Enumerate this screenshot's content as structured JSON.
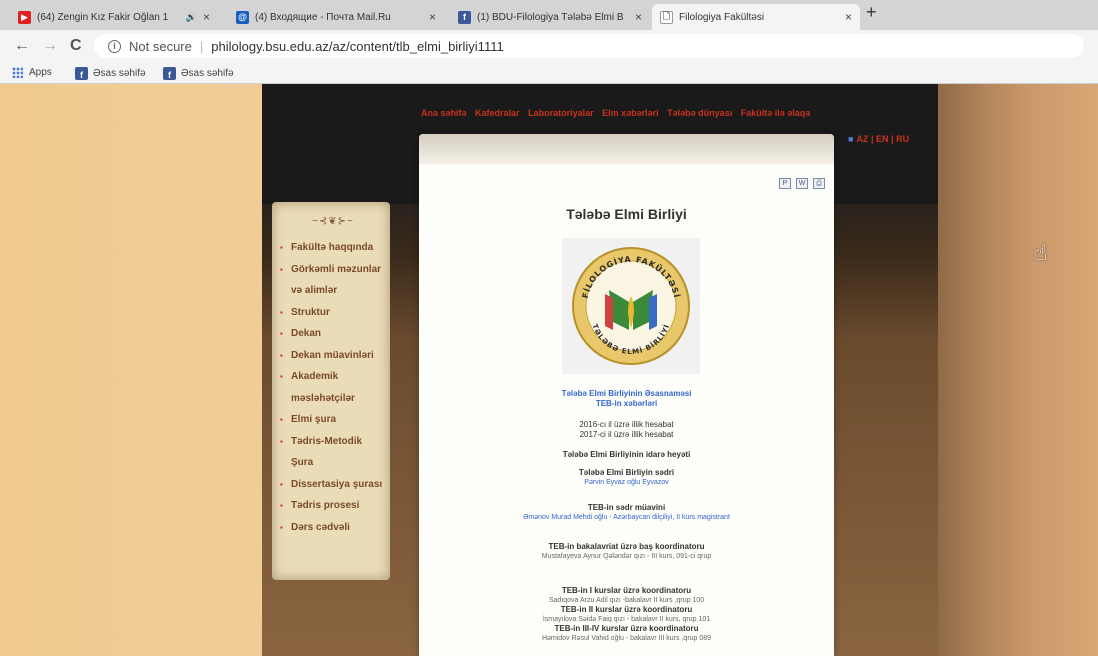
{
  "tabs": [
    {
      "title": "(64) Zengin Kız Fakir Oğlan 1",
      "fav_color": "#e02020",
      "fav_glyph": "▶",
      "audio": "🔊"
    },
    {
      "title": "(4) Входящие - Почта Mail.Ru",
      "fav_color": "#1a5fc0",
      "fav_glyph": "@"
    },
    {
      "title": "(1) BDU-Filologiya Tələbə Elmi B",
      "fav_color": "#3b5998",
      "fav_glyph": "f"
    },
    {
      "title": "Filologiya Fakültəsi",
      "fav_color": "#ffffff",
      "fav_glyph": "🗋"
    }
  ],
  "new_tab": "+",
  "close_glyph": "×",
  "nav": {
    "back": "←",
    "forward": "→",
    "reload": "C"
  },
  "address": {
    "info": "i",
    "security": "Not secure",
    "separator": "|",
    "url": "philology.bsu.edu.az/az/content/tlb_elmi_birliyi1111"
  },
  "bookmarks": {
    "apps": "Apps",
    "items": [
      "Əsas səhifə",
      "Əsas səhifə"
    ]
  },
  "site": {
    "menu": [
      "Ana səhifə",
      "Kafedralar",
      "Laboratoriyalar",
      "Elm xəbərləri",
      "Tələbə dünyası",
      "Fakültə ilə əlaqə"
    ],
    "lang": {
      "az": "AZ",
      "en": "EN",
      "ru": "RU",
      "sep": "|"
    },
    "sidebar": [
      {
        "label": "Fakültə haqqında"
      },
      {
        "label": "Görkəmli məzunlar",
        "cont": "və alimlər"
      },
      {
        "label": "Struktur"
      },
      {
        "label": "Dekan"
      },
      {
        "label": "Dekan müavinləri"
      },
      {
        "label": "Akademik",
        "cont": "məsləhətçilər"
      },
      {
        "label": "Elmi şura"
      },
      {
        "label": "Tədris-Metodik",
        "cont": "Şura"
      },
      {
        "label": "Dissertasiya şurası"
      },
      {
        "label": "Tədris prosesi"
      },
      {
        "label": "Dərs cədvəli"
      }
    ],
    "page_title": "Tələbə Elmi Birliyi",
    "logo_text": {
      "top": "FİLOLOGİYA FAKÜLTƏSİ",
      "bottom": "TƏLƏBƏ ELMİ BİRLİYİ"
    },
    "links": [
      "Tələbə Elmi Birliyinin Əsasnaməsi",
      "TEB-in xəbərləri"
    ],
    "reports": [
      "2016-cı il üzrə illik hesabat",
      "2017-ci il üzrə illik hesabat"
    ],
    "board_title": "Tələbə Elmi Birliyinin idarə heyəti",
    "chair": {
      "role": "Tələbə Elmi Birliyin sədri",
      "name": "Pərvin Eyvaz oğlu Eyvazov"
    },
    "vice": {
      "role": "TEB-in sədr müavini",
      "name": "Əmənov Murad Mehdi oğlu - Azərbaycan dilçiliyi, II kurs magistrant"
    },
    "bachelor": {
      "role": "TEB-in bakalavriat üzrə baş koordinatoru",
      "name": "Mustafayeva Aynur Qələndər qızı - III kurs, 091-ci qrup"
    },
    "coord1": {
      "role": "TEB-in I kurslar üzrə koordinatoru",
      "name": "Sadıqova Arzu Adil qızı -bakalavr II kurs ,qrup 100"
    },
    "coord2": {
      "role": "TEB-in II kurslar üzrə koordinatoru",
      "name": "İsmayılova Səidə Faiq qızı - bakalavr II kurs, qrup 101"
    },
    "coord3": {
      "role": "TEB-in III-IV kurslar üzrə koordinatoru",
      "name": "Həmidov Rəsul Vahid oğlu - bakalavr III kurs ,qrup 089"
    }
  },
  "colors": {
    "menu_red": "#c8321e",
    "link_blue": "#3366cc",
    "sidebar_brown": "#7a4a28"
  }
}
